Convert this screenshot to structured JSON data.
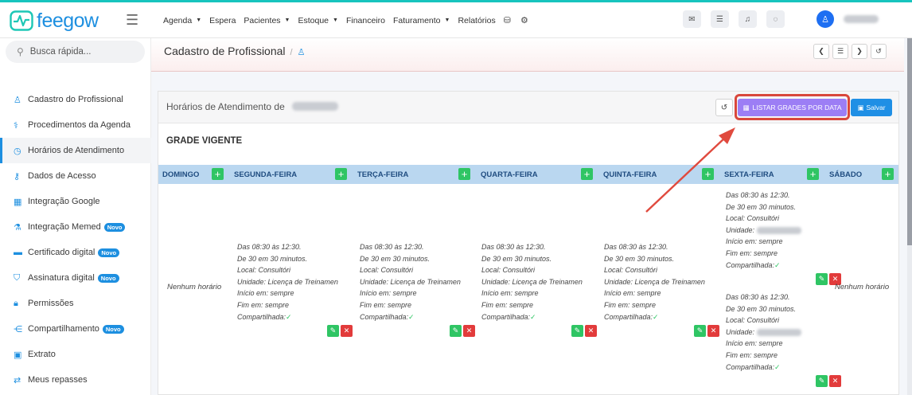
{
  "app": {
    "logo_text": "feegow",
    "nav": [
      {
        "label": "Agenda",
        "dropdown": true
      },
      {
        "label": "Espera",
        "dropdown": false
      },
      {
        "label": "Pacientes",
        "dropdown": true
      },
      {
        "label": "Estoque",
        "dropdown": true
      },
      {
        "label": "Financeiro",
        "dropdown": false
      },
      {
        "label": "Faturamento",
        "dropdown": true
      },
      {
        "label": "Relatórios",
        "dropdown": false
      }
    ],
    "nav_icons": [
      "database-icon",
      "gear-icon"
    ],
    "toolbar_icons": [
      "inbox-icon",
      "checklist-icon",
      "bell-icon",
      "chat-icon"
    ],
    "avatar_icon": "user-icon"
  },
  "sidebar": {
    "search_placeholder": "Busca rápida...",
    "items": [
      {
        "label": "Cadastro do Profissional",
        "icon": "user-icon",
        "glyph": "♙",
        "badge": ""
      },
      {
        "label": "Procedimentos da Agenda",
        "icon": "stethoscope-icon",
        "glyph": "⚕",
        "badge": ""
      },
      {
        "label": "Horários de Atendimento",
        "icon": "clock-icon",
        "glyph": "◷",
        "badge": "",
        "active": true
      },
      {
        "label": "Dados de Acesso",
        "icon": "key-icon",
        "glyph": "⚷",
        "badge": ""
      },
      {
        "label": "Integração Google",
        "icon": "calendar-icon",
        "glyph": "▦",
        "badge": ""
      },
      {
        "label": "Integração Memed",
        "icon": "flask-icon",
        "glyph": "⚗",
        "badge": "Novo"
      },
      {
        "label": "Certificado digital",
        "icon": "card-icon",
        "glyph": "▬",
        "badge": "Novo"
      },
      {
        "label": "Assinatura digital",
        "icon": "shield-icon",
        "glyph": "⛉",
        "badge": "Novo"
      },
      {
        "label": "Permissões",
        "icon": "lock-icon",
        "glyph": "🔒︎",
        "badge": ""
      },
      {
        "label": "Compartilhamento",
        "icon": "share-icon",
        "glyph": "⋲",
        "badge": "Novo"
      },
      {
        "label": "Extrato",
        "icon": "money-icon",
        "glyph": "▣",
        "badge": ""
      },
      {
        "label": "Meus repasses",
        "icon": "transfer-icon",
        "glyph": "⇄",
        "badge": ""
      }
    ]
  },
  "page": {
    "title": "Cadastro de Profissional",
    "separator": "/",
    "title_icon": "user-icon"
  },
  "panel": {
    "title": "Horários de Atendimento de",
    "list_button": "LISTAR GRADES POR DATA",
    "save_button": "Salvar",
    "grade_title": "GRADE VIGENTE"
  },
  "days": [
    "DOMINGO",
    "SEGUNDA-FEIRA",
    "TERÇA-FEIRA",
    "QUARTA-FEIRA",
    "QUINTA-FEIRA",
    "SEXTA-FEIRA",
    "SÁBADO"
  ],
  "schedule": {
    "no_schedule": "Nenhum horário",
    "block_lines": {
      "time": "Das 08:30 às 12:30.",
      "interval": "De 30 em 30 minutos.",
      "local": "Local: Consultóri",
      "unit_label": "Unidade:",
      "unit_value": "Licença de Treinamen",
      "start": "Início em: sempre",
      "end": "Fim em: sempre",
      "shared": "Compartilhada:"
    }
  }
}
